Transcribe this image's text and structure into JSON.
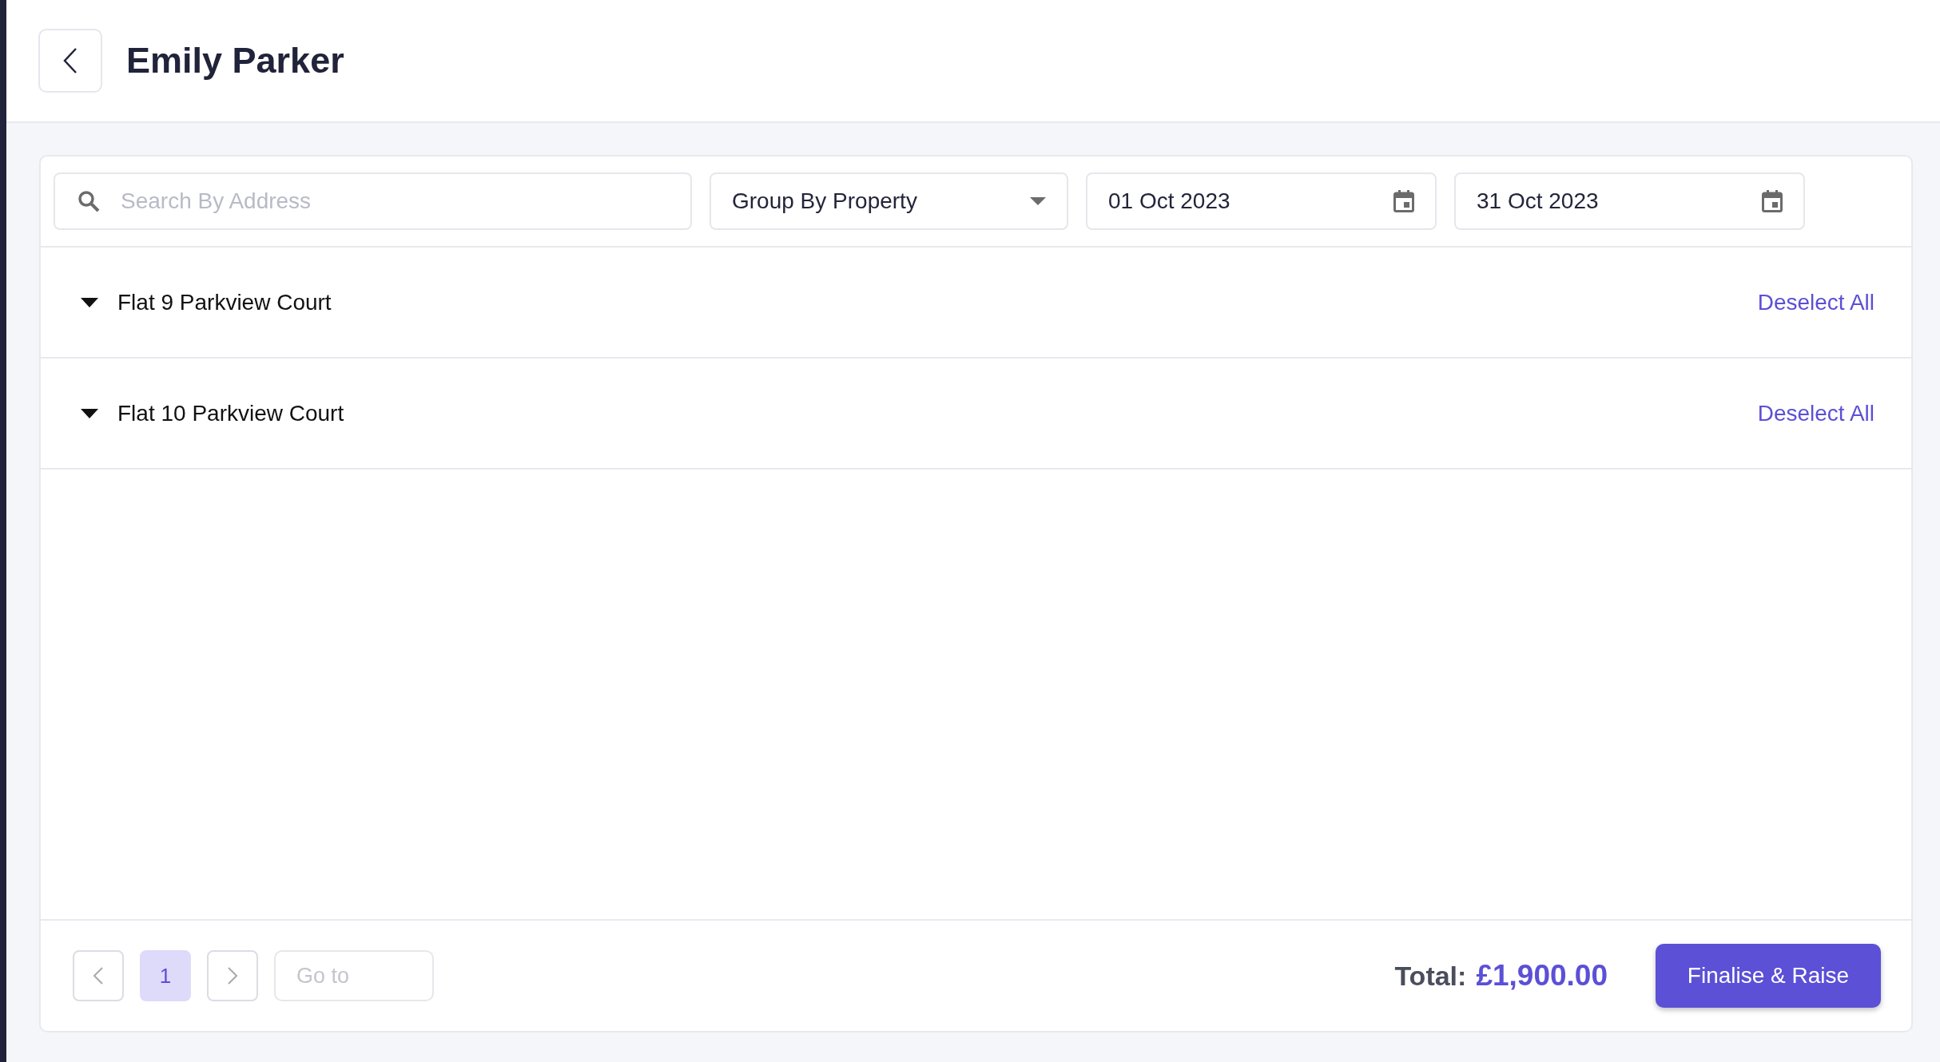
{
  "header": {
    "title": "Emily Parker"
  },
  "filters": {
    "search": {
      "placeholder": "Search By Address"
    },
    "group_by": {
      "value": "Group By Property"
    },
    "dates": [
      {
        "value": "01 Oct 2023"
      },
      {
        "value": "31 Oct 2023"
      }
    ]
  },
  "groups": [
    {
      "name": "Flat 9 Parkview Court",
      "expanded": true,
      "action": "Deselect All"
    },
    {
      "name": "Flat 10 Parkview Court",
      "expanded": true,
      "action": "Deselect All"
    }
  ],
  "pagination": {
    "pages": [
      {
        "label": "1",
        "selected": true
      }
    ],
    "goto": {
      "placeholder": "Go to"
    }
  },
  "footer": {
    "total_label": "Total:",
    "total_value": "£1,900.00",
    "button": "Finalise & Raise"
  }
}
